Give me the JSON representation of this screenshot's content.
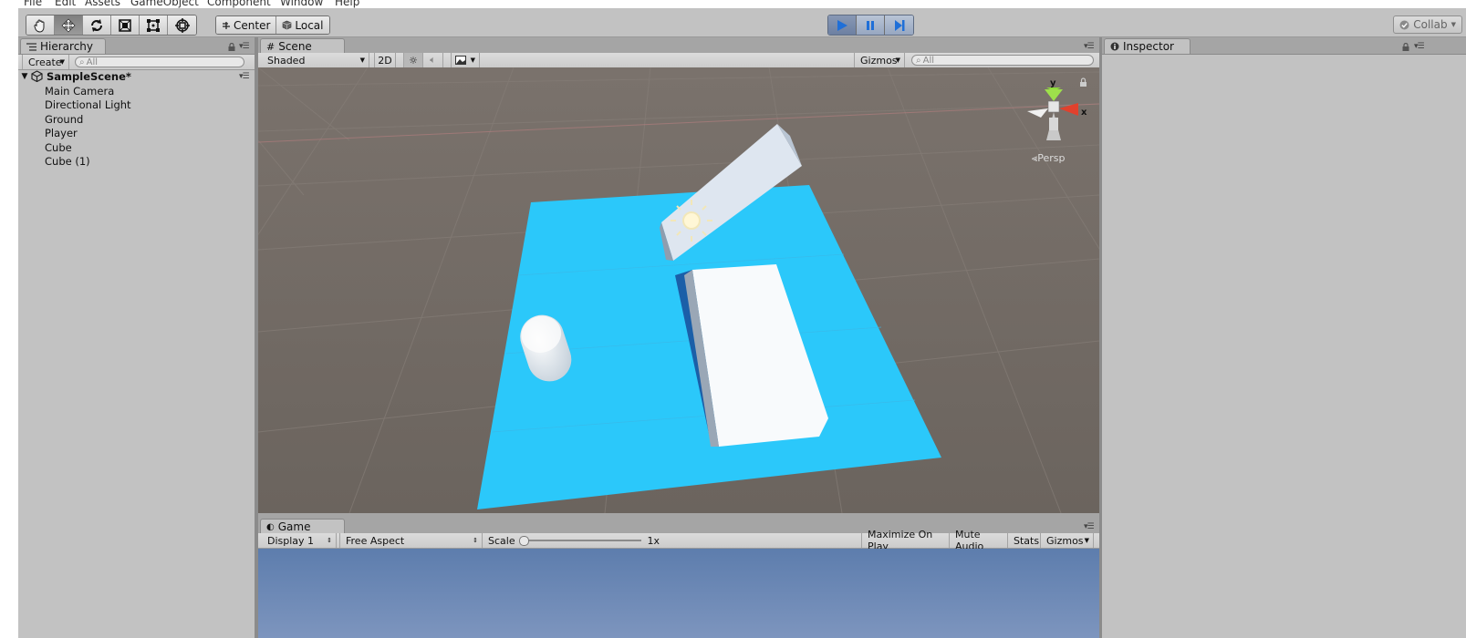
{
  "menu": [
    "File",
    "Edit",
    "Assets",
    "GameObject",
    "Component",
    "Window",
    "Help"
  ],
  "toolbar": {
    "tools": [
      {
        "name": "hand-tool",
        "icon": "hand-icon"
      },
      {
        "name": "move-tool",
        "icon": "move-icon"
      },
      {
        "name": "rotate-tool",
        "icon": "rotate-icon"
      },
      {
        "name": "scale-tool",
        "icon": "scale-icon"
      },
      {
        "name": "rect-tool",
        "icon": "rect-icon"
      },
      {
        "name": "transform-tool",
        "icon": "transform-icon"
      }
    ],
    "pivot_label": "Center",
    "rotation_label": "Local",
    "collab_label": "Collab"
  },
  "hierarchy": {
    "tab_label": "Hierarchy",
    "create_label": "Create",
    "search_placeholder": "All",
    "scene_name": "SampleScene*",
    "items": [
      "Main Camera",
      "Directional Light",
      "Ground",
      "Player",
      "Cube",
      "Cube (1)"
    ]
  },
  "scene": {
    "tab_label": "Scene",
    "shading_mode": "Shaded",
    "mode_2d": "2D",
    "gizmos_label": "Gizmos",
    "search_placeholder": "All",
    "projection_label": "Persp",
    "axis_y": "y",
    "axis_x": "x"
  },
  "game": {
    "tab_label": "Game",
    "display": "Display 1",
    "aspect": "Free Aspect",
    "scale_label": "Scale",
    "scale_value": "1x",
    "maximize_label": "Maximize On Play",
    "mute_label": "Mute Audio",
    "stats_label": "Stats",
    "gizmos_label": "Gizmos"
  },
  "inspector": {
    "tab_label": "Inspector"
  },
  "colors": {
    "panel": "#c2c2c2",
    "scene_bg": "#716a64",
    "ground": "#2bc8fa",
    "play_active": "#1f6fd8"
  }
}
